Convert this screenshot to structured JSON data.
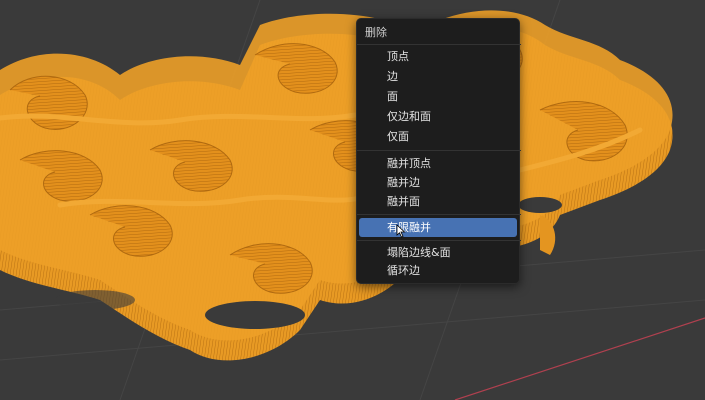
{
  "menu": {
    "title": "删除",
    "active_index": 8,
    "groups": [
      [
        "顶点",
        "边",
        "面",
        "仅边和面",
        "仅面"
      ],
      [
        "融并顶点",
        "融并边",
        "融并面"
      ],
      [
        "有限融并"
      ],
      [
        "塌陷边线&面",
        "循环边"
      ]
    ],
    "items": [
      {
        "label": "顶点"
      },
      {
        "label": "边"
      },
      {
        "label": "面"
      },
      {
        "label": "仅边和面"
      },
      {
        "label": "仅面"
      },
      {
        "label": "融并顶点"
      },
      {
        "label": "融并边"
      },
      {
        "label": "融并面"
      },
      {
        "label": "有限融并"
      },
      {
        "label": "塌陷边线&面"
      },
      {
        "label": "循环边"
      }
    ]
  },
  "viewport": {
    "background_color": "#3a3a3a",
    "mesh_color": "#e9961f",
    "mesh_shadow_color": "#b56c10",
    "wire_color": "#9a5a08",
    "axis_line_color": "#b0404f"
  },
  "colors": {
    "menu_bg": "#1d1d1d",
    "highlight": "#4772b3",
    "text": "#e3e3e3"
  }
}
